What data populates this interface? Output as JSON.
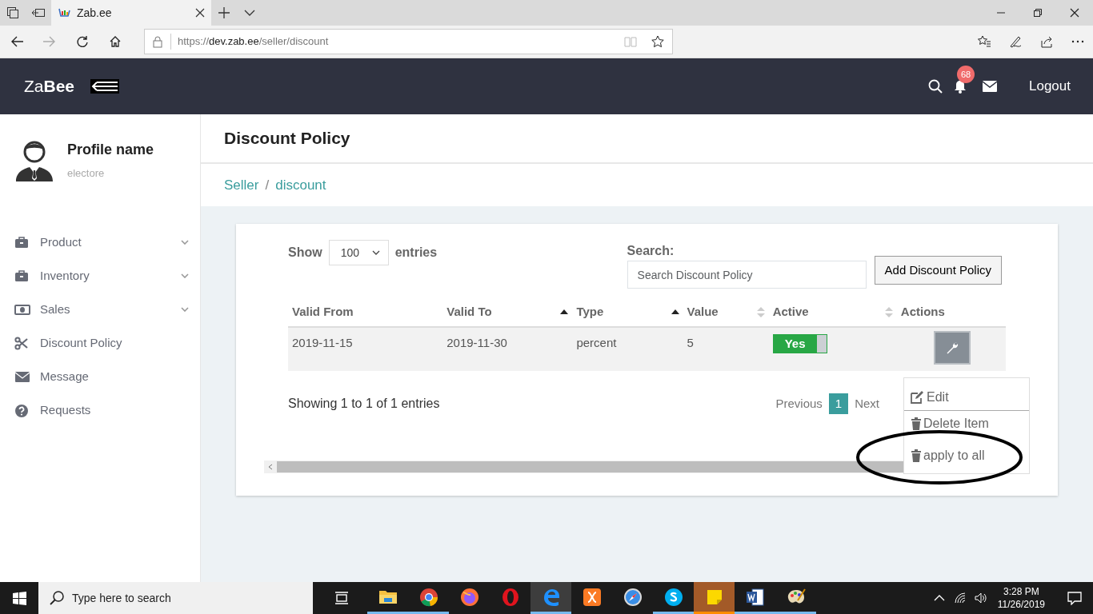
{
  "browser": {
    "tab_title": "Zab.ee",
    "url_scheme": "https://",
    "url_host": "dev.zab.ee",
    "url_path": "/seller/discount"
  },
  "app": {
    "logo": "Za**Bee**",
    "notification_count": "68",
    "logout": "Logout"
  },
  "profile": {
    "name": "Profile name",
    "subtitle": "electore"
  },
  "sidebar": {
    "items": [
      {
        "label": "Product",
        "kind": "briefcase",
        "has_submenu": true
      },
      {
        "label": "Inventory",
        "kind": "briefcase",
        "has_submenu": true
      },
      {
        "label": "Sales",
        "kind": "money",
        "has_submenu": true
      },
      {
        "label": "Discount Policy",
        "kind": "scissors",
        "has_submenu": false
      },
      {
        "label": "Message",
        "kind": "envelope",
        "has_submenu": false
      },
      {
        "label": "Requests",
        "kind": "question",
        "has_submenu": false
      }
    ]
  },
  "page": {
    "title": "Discount Policy",
    "breadcrumb": [
      {
        "label": "Seller"
      },
      {
        "label": "discount"
      }
    ],
    "breadcrumb_separator": "/"
  },
  "table": {
    "show_label": "Show",
    "page_size": "100",
    "entries_label": "entries",
    "search_label": "Search:",
    "search_placeholder": "Search Discount Policy",
    "add_button": "Add Discount Policy",
    "columns": [
      {
        "label": "Valid From",
        "sortable": false,
        "sorted": false
      },
      {
        "label": "Valid To",
        "sortable": true,
        "sorted": true
      },
      {
        "label": "Type",
        "sortable": true,
        "sorted": true
      },
      {
        "label": "Value",
        "sortable": true,
        "sorted": false
      },
      {
        "label": "Active",
        "sortable": true,
        "sorted": false
      },
      {
        "label": "Actions",
        "sortable": false,
        "sorted": false
      }
    ],
    "rows": [
      {
        "valid_from": "2019-11-15",
        "valid_to": "2019-11-30",
        "type": "percent",
        "value": "5",
        "active": true,
        "active_label": "Yes"
      }
    ],
    "info": "Showing 1 to 1 of 1 entries",
    "pagination": {
      "previous": "Previous",
      "pages": [
        {
          "label": "1",
          "selected": true
        }
      ],
      "next": "Next"
    }
  },
  "action_menu": {
    "items": [
      {
        "label": "Edit",
        "kind": "edit"
      },
      {
        "label": "Delete Item",
        "kind": "trash"
      },
      {
        "label": "apply to all",
        "kind": "trash"
      }
    ]
  },
  "taskbar": {
    "search_placeholder": "Type here to search",
    "time": "3:28 PM",
    "date": "11/26/2019",
    "apps": [
      {
        "kind": "explorer",
        "open": true,
        "active": false,
        "flashing": false
      },
      {
        "kind": "chrome",
        "open": true,
        "active": false,
        "flashing": false
      },
      {
        "kind": "firefox",
        "open": false,
        "active": false,
        "flashing": false
      },
      {
        "kind": "opera",
        "open": false,
        "active": false,
        "flashing": false
      },
      {
        "kind": "edge",
        "open": true,
        "active": true,
        "flashing": false
      },
      {
        "kind": "xampp",
        "open": false,
        "active": false,
        "flashing": false
      },
      {
        "kind": "safari",
        "open": false,
        "active": false,
        "flashing": false
      },
      {
        "kind": "skype",
        "open": true,
        "active": false,
        "flashing": false
      },
      {
        "kind": "sticky",
        "open": true,
        "active": false,
        "flashing": true
      },
      {
        "kind": "word",
        "open": true,
        "active": false,
        "flashing": false
      },
      {
        "kind": "paint",
        "open": true,
        "active": false,
        "flashing": false
      }
    ]
  }
}
